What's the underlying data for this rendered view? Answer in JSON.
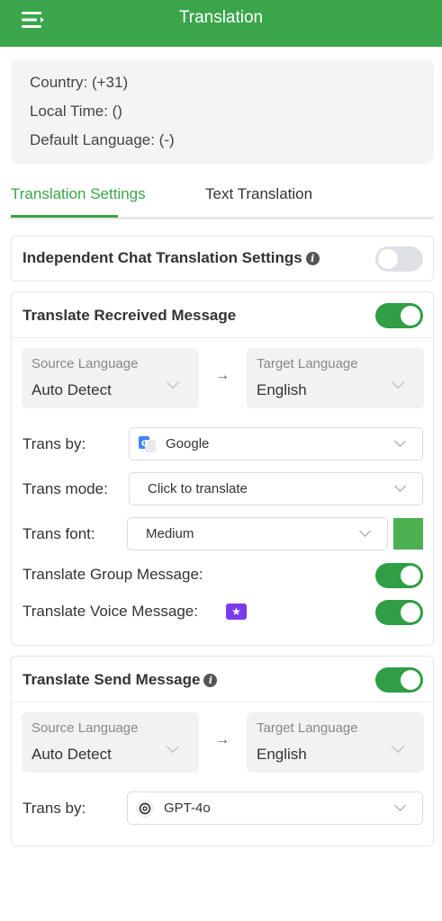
{
  "header": {
    "title": "Translation",
    "menu_icon": "menu-icon"
  },
  "info": {
    "country": "Country: (+31)",
    "local_time": "Local Time: ()",
    "default_language": "Default Language: (-)"
  },
  "tabs": [
    {
      "label": "Translation Settings",
      "active": true
    },
    {
      "label": "Text Translation",
      "active": false
    }
  ],
  "independent": {
    "title": "Independent Chat Translation Settings",
    "enabled": false
  },
  "received": {
    "title": "Translate Recreived Message",
    "enabled": true,
    "source_label": "Source Language",
    "source_value": "Auto Detect",
    "target_label": "Target Language",
    "target_value": "English",
    "arrow": "→",
    "trans_by_label": "Trans by:",
    "trans_by_value": "Google",
    "trans_mode_label": "Trans mode:",
    "trans_mode_value": "Click to translate",
    "trans_font_label": "Trans font:",
    "trans_font_value": "Medium",
    "font_color": "#4cb050",
    "group_label": "Translate Group Message:",
    "group_enabled": true,
    "voice_label": "Translate Voice Message:",
    "voice_enabled": true
  },
  "send": {
    "title": "Translate Send Message",
    "enabled": true,
    "source_label": "Source Language",
    "source_value": "Auto Detect",
    "target_label": "Target Language",
    "target_value": "English",
    "arrow": "→",
    "trans_by_label": "Trans by:",
    "trans_by_value": "GPT-4o"
  },
  "colors": {
    "accent": "#3aa54a",
    "toggle_on": "#2f9e44",
    "premium": "#7c3aed"
  }
}
